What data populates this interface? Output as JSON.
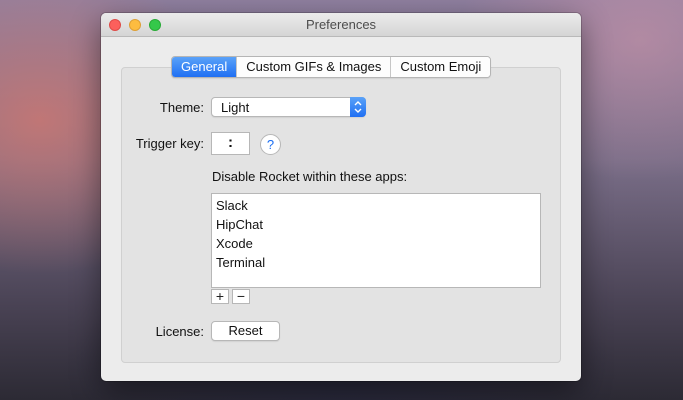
{
  "window": {
    "title": "Preferences"
  },
  "tabs": [
    {
      "label": "General",
      "active": true
    },
    {
      "label": "Custom GIFs & Images",
      "active": false
    },
    {
      "label": "Custom Emoji",
      "active": false
    }
  ],
  "theme": {
    "label": "Theme:",
    "value": "Light"
  },
  "trigger": {
    "label": "Trigger key:",
    "value": ":",
    "help_glyph": "?"
  },
  "disable_apps": {
    "caption": "Disable Rocket within these apps:",
    "items": [
      "Slack",
      "HipChat",
      "Xcode",
      "Terminal"
    ],
    "add_glyph": "+",
    "remove_glyph": "−"
  },
  "license": {
    "label": "License:",
    "button": "Reset"
  },
  "colors": {
    "accent": "#1f6ff3",
    "window_bg": "#ececec",
    "close": "#fc605c",
    "minimize": "#fdbc40",
    "maximize": "#34c84a"
  },
  "icons": {
    "close": "close-icon",
    "minimize": "minimize-icon",
    "maximize": "maximize-icon",
    "popup_arrows": "chevron-up-down-icon",
    "help": "question-mark-icon",
    "add": "plus-icon",
    "remove": "minus-icon"
  }
}
